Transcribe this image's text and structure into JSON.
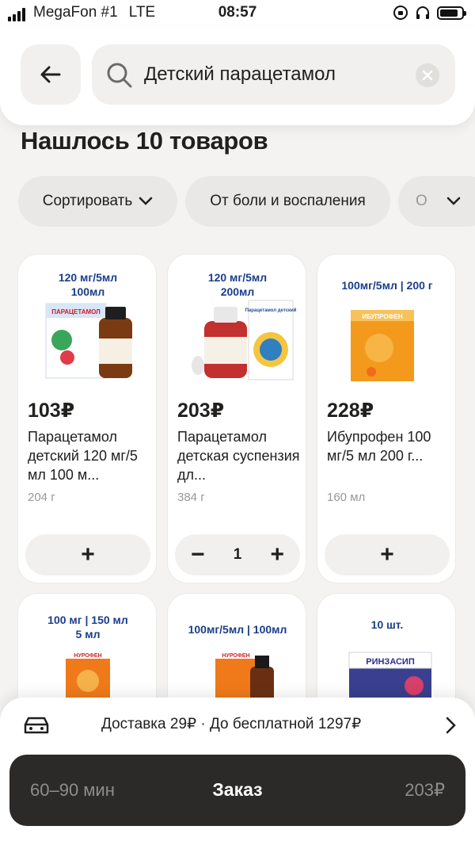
{
  "status_bar": {
    "carrier": "MegaFon #1",
    "network": "LTE",
    "time": "08:57"
  },
  "search": {
    "value": "Детский парацетамол",
    "icons": [
      "back-arrow-icon",
      "search-icon",
      "clear-icon"
    ]
  },
  "results_title": "Нашлось 10 товаров",
  "filters": {
    "sort_label": "Сортировать",
    "category_label": "От боли и воспаления",
    "next_label": "О"
  },
  "products": [
    {
      "tag_line1": "120 мг/5мл",
      "tag_line2": "100мл",
      "price": "103₽",
      "name": "Парацетамол детский 120 мг/5 мл 100 м...",
      "weight": "204 г",
      "add_label": "+"
    },
    {
      "tag_line1": "120 мг/5мл",
      "tag_line2": "200мл",
      "price": "203₽",
      "name": "Парацетамол детская суспензия дл...",
      "weight": "384 г",
      "minus_label": "−",
      "quantity": "1",
      "plus_label": "+"
    },
    {
      "tag_line1": "100мг/5мл | 200 г",
      "price": "228₽",
      "name": "Ибупрофен 100 мг/5 мл 200 г...",
      "weight": "160 мл",
      "add_label": "+"
    },
    {
      "tag_line1": "100 мг | 150 мл",
      "tag_line2": "5 мл"
    },
    {
      "tag_line1": "100мг/5мл | 100мл"
    },
    {
      "tag_line1": "10 шт.",
      "brand": "РИНЗАСИП"
    }
  ],
  "package_text": {
    "p1": "ПАРАЦЕТАМОЛ",
    "p2": "Парацетамол детский",
    "p3": "ИБУПРОФЕН",
    "p4": "НУРОФЕН",
    "p5": "НУРОФЕН"
  },
  "delivery": {
    "text": "Доставка 29₽ · До бесплатной 1297₽"
  },
  "order": {
    "time": "60–90 мин",
    "label": "Заказ",
    "sum": "203₽"
  },
  "colors": {
    "accent_dark": "#2b2a29",
    "chip_bg": "#e9e8e6",
    "tag_blue": "#1b3e8a"
  }
}
